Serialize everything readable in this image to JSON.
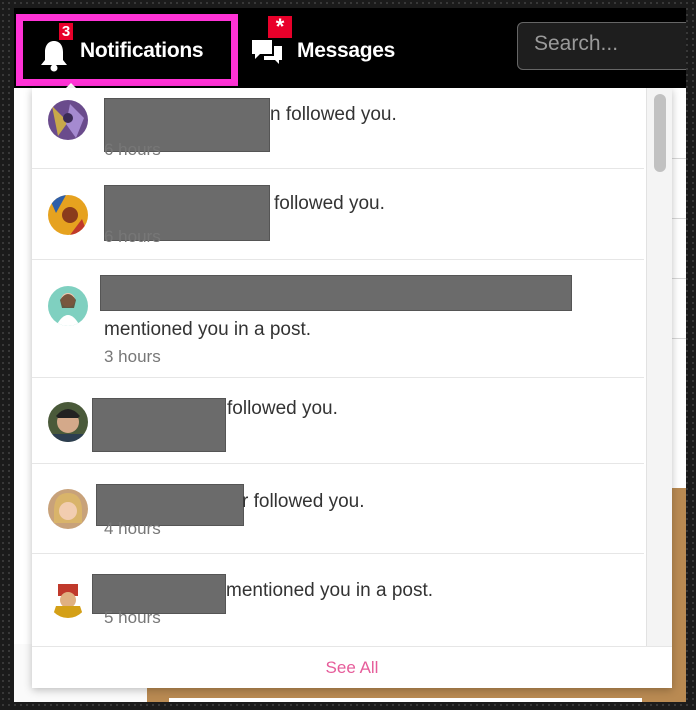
{
  "topbar": {
    "notifications_label": "Notifications",
    "notifications_badge": "3",
    "messages_label": "Messages",
    "messages_badge": "*",
    "search_placeholder": "Search...",
    "highlight_color": "#ff33d6",
    "badge_color": "#e8002a"
  },
  "notifications": [
    {
      "avatar": "avatar-1",
      "visible_text": "n followed you.",
      "time": "6 hours"
    },
    {
      "avatar": "avatar-2",
      "visible_text": "followed you.",
      "time": "6 hours"
    },
    {
      "avatar": "avatar-3",
      "visible_text": "mentioned you in a post.",
      "time": "3 hours"
    },
    {
      "avatar": "avatar-4",
      "visible_text": "followed you.",
      "time": ""
    },
    {
      "avatar": "avatar-5",
      "visible_text": "r followed you.",
      "time": "4 hours"
    },
    {
      "avatar": "avatar-6",
      "visible_text": "mentioned you in a post.",
      "time": "5 hours"
    }
  ],
  "footer": {
    "see_all_label": "See All",
    "link_color": "#e65c9a"
  }
}
